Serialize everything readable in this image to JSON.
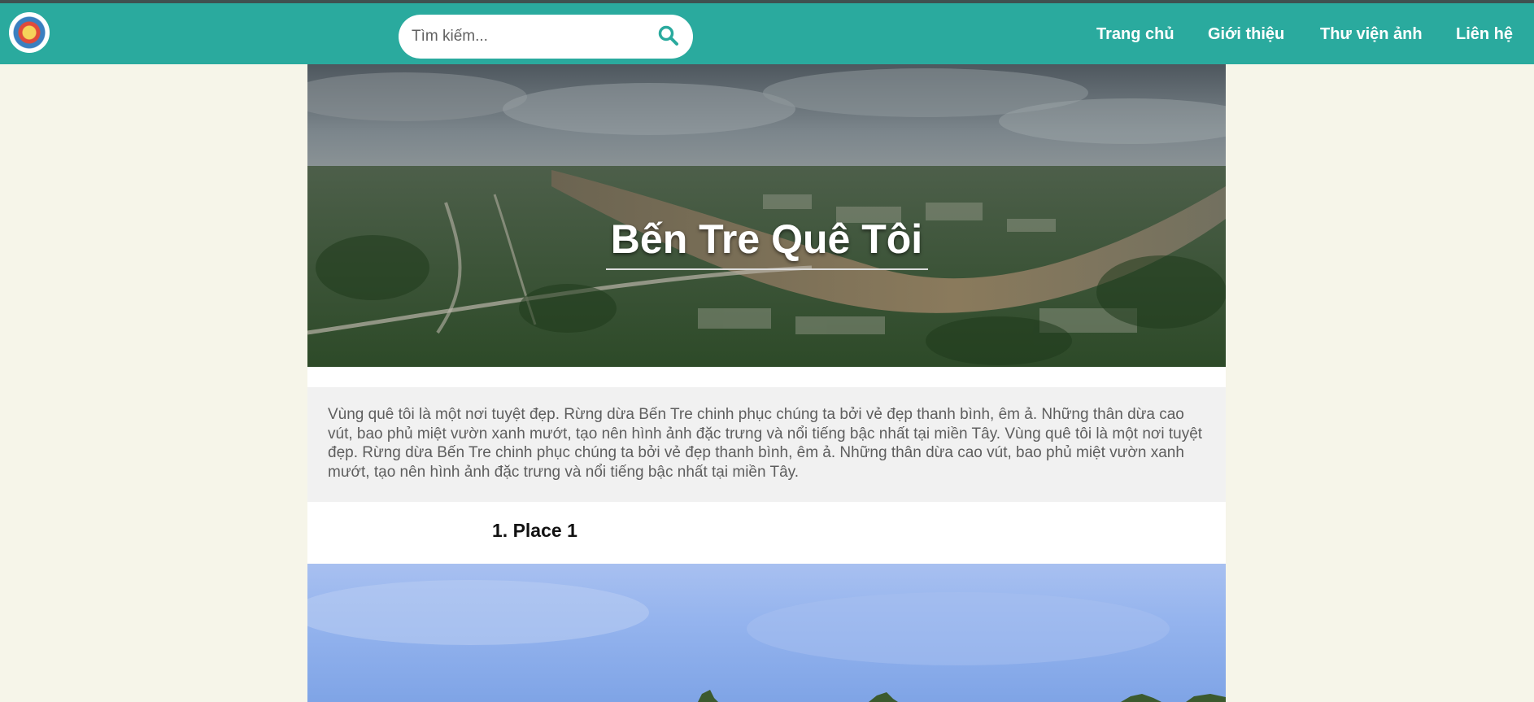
{
  "header": {
    "search_placeholder": "Tìm kiếm...",
    "search_icon": "search-icon",
    "nav": [
      {
        "label": "Trang chủ"
      },
      {
        "label": "Giới thiệu"
      },
      {
        "label": "Thư viện ảnh"
      },
      {
        "label": "Liên hệ"
      }
    ],
    "colors": {
      "bar": "#2aaa9e",
      "background": "#f6f5e9"
    }
  },
  "hero": {
    "title": "Bến Tre Quê Tôi"
  },
  "intro": {
    "text": "Vùng quê tôi là một nơi tuyệt đẹp. Rừng dừa Bến Tre chinh phục chúng ta bởi vẻ đẹp thanh bình, êm ả. Những thân dừa cao vút, bao phủ miệt vườn xanh mướt, tạo nên hình ảnh đặc trưng và nổi tiếng bậc nhất tại miền Tây. Vùng quê tôi là một nơi tuyệt đẹp. Rừng dừa Bến Tre chinh phục chúng ta bởi vẻ đẹp thanh bình, êm ả. Những thân dừa cao vút, bao phủ miệt vườn xanh mướt, tạo nên hình ảnh đặc trưng và nổi tiếng bậc nhất tại miền Tây."
  },
  "places": [
    {
      "title": "1. Place 1"
    }
  ]
}
